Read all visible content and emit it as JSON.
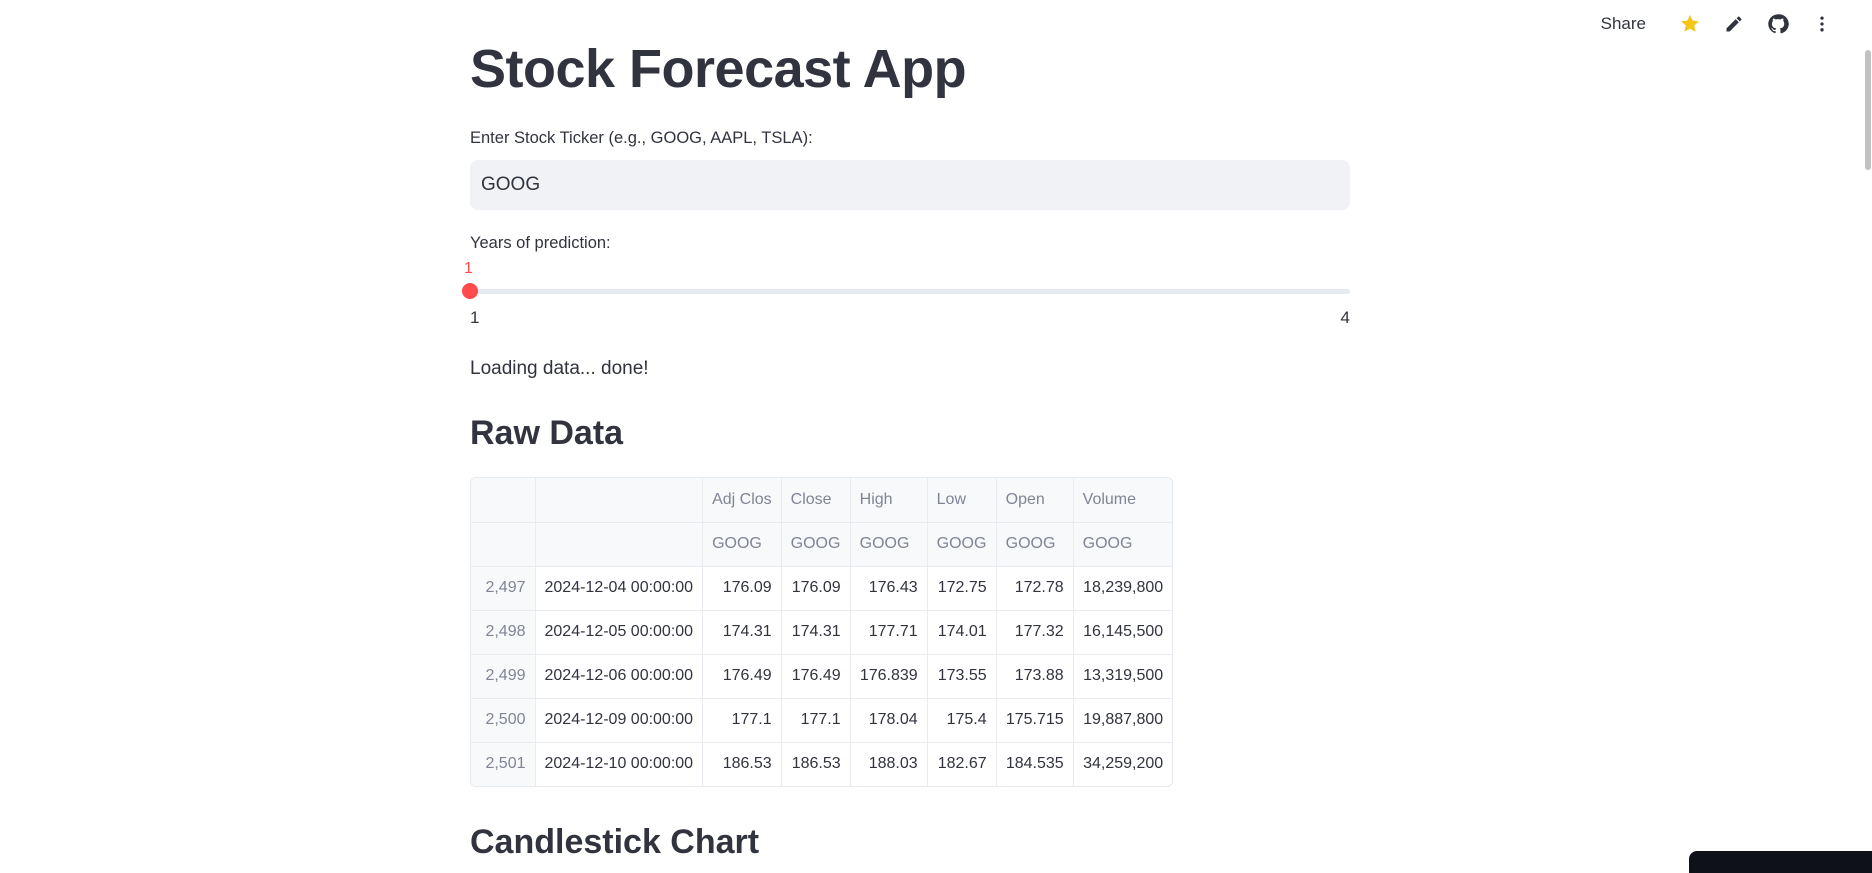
{
  "toolbar": {
    "share_label": "Share",
    "icons": [
      "star-icon",
      "pencil-icon",
      "github-icon",
      "more-vertical-icon"
    ],
    "star_color": "#f5c518"
  },
  "app": {
    "title": "Stock Forecast App",
    "ticker_label": "Enter Stock Ticker (e.g., GOOG, AAPL, TSLA):",
    "ticker_value": "GOOG",
    "years_label": "Years of prediction:",
    "years_value": "1",
    "years_min": "1",
    "years_max": "4",
    "status": "Loading data... done!",
    "raw_data_heading": "Raw Data",
    "candlestick_heading": "Candlestick Chart",
    "accent_color": "#ff4b4b"
  },
  "table": {
    "header_row1": [
      "",
      "",
      "Adj Clos",
      "Close",
      "High",
      "Low",
      "Open",
      "Volume"
    ],
    "header_row2": [
      "",
      "",
      "GOOG",
      "GOOG",
      "GOOG",
      "GOOG",
      "GOOG",
      "GOOG"
    ],
    "rows": [
      [
        "2,497",
        "2024-12-04 00:00:00",
        "176.09",
        "176.09",
        "176.43",
        "172.75",
        "172.78",
        "18,239,800"
      ],
      [
        "2,498",
        "2024-12-05 00:00:00",
        "174.31",
        "174.31",
        "177.71",
        "174.01",
        "177.32",
        "16,145,500"
      ],
      [
        "2,499",
        "2024-12-06 00:00:00",
        "176.49",
        "176.49",
        "176.839",
        "173.55",
        "173.88",
        "13,319,500"
      ],
      [
        "2,500",
        "2024-12-09 00:00:00",
        "177.1",
        "177.1",
        "178.04",
        "175.4",
        "175.715",
        "19,887,800"
      ],
      [
        "2,501",
        "2024-12-10 00:00:00",
        "186.53",
        "186.53",
        "188.03",
        "182.67",
        "184.535",
        "34,259,200"
      ]
    ]
  }
}
